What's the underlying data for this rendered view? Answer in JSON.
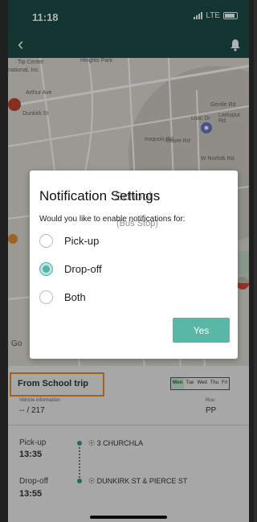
{
  "status_bar": {
    "time": "11:18",
    "network": "LTE"
  },
  "map": {
    "labels": [
      "Tip Center",
      "Heights Park",
      "national, Inc",
      "Arthur Ave",
      "Dunkirk St",
      "Larkspur Rd",
      "Iroquois Rd",
      "Moore Rd",
      "Lilac Dr",
      "Gentle Rd",
      "W Norfolk Rd",
      "Go"
    ]
  },
  "dialog": {
    "title": "Notification Settings",
    "ghost_title": "School",
    "message": "Would you like to enable notifications for:",
    "ghost_message": "(Bus Stop)",
    "options": [
      {
        "label": "Pick-up",
        "selected": false
      },
      {
        "label": "Drop-off",
        "selected": true
      },
      {
        "label": "Both",
        "selected": false
      }
    ],
    "confirm_label": "Yes"
  },
  "trip": {
    "title": "From School trip",
    "days": [
      "Mon",
      "Tue",
      "Wed",
      "Thu",
      "Fri"
    ],
    "active_day": "Mon",
    "vehicle_label": "Vehicle information",
    "vehicle_value": "-- / 217",
    "route_label": "Rou",
    "route_value": "PP",
    "stops": [
      {
        "label": "Pick-up",
        "time": "13:35",
        "address": "3 CHURCHLA"
      },
      {
        "label": "Drop-off",
        "time": "13:55",
        "address": "DUNKIRK ST & PIERCE ST"
      }
    ]
  },
  "colors": {
    "header": "#1c4d47",
    "accent": "#59b7a6",
    "highlight": "#f08a24"
  }
}
